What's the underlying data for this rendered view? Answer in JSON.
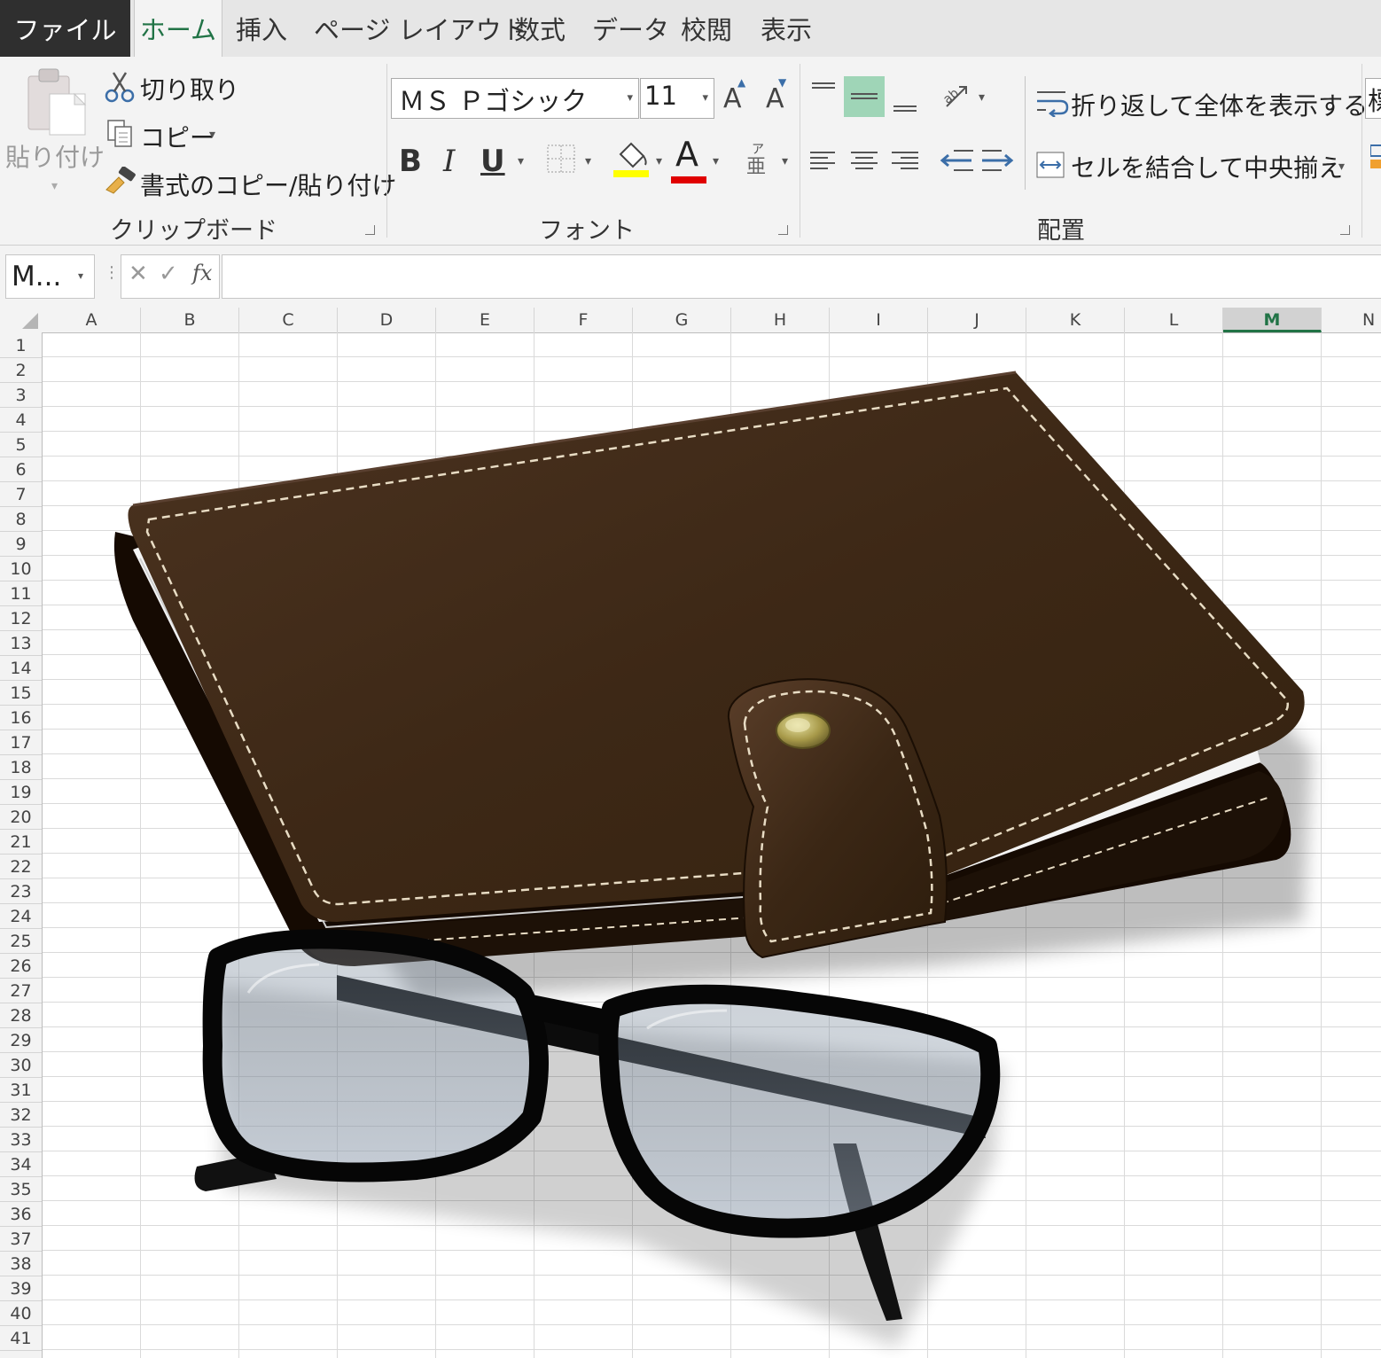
{
  "tabs": {
    "file": "ファイル",
    "home": "ホーム",
    "insert": "挿入",
    "page_layout": "ページ レイアウト",
    "formulas": "数式",
    "data": "データ",
    "review": "校閲",
    "view": "表示"
  },
  "clipboard": {
    "paste": "貼り付け",
    "cut": "切り取り",
    "copy": "コピー",
    "format_painter": "書式のコピー/貼り付け",
    "group": "クリップボード"
  },
  "font": {
    "name": "ＭＳ Ｐゴシック",
    "size": "11",
    "bold": "B",
    "italic": "I",
    "underline": "U",
    "grow": "A",
    "shrink": "A",
    "color": "A",
    "phonetic": "亜",
    "phonetic_ruby": "ア",
    "group": "フォント",
    "fill_color": "#ffff00",
    "font_color": "#ff0000"
  },
  "alignment": {
    "wrap_text": "折り返して全体を表示する",
    "merge_center": "セルを結合して中央揃え",
    "group": "配置"
  },
  "number": {
    "format_fragment": "標"
  },
  "formula_bar": {
    "name_box": "M...",
    "fx": "fx",
    "value": ""
  },
  "columns": [
    "A",
    "B",
    "C",
    "D",
    "E",
    "F",
    "G",
    "H",
    "I",
    "J",
    "K",
    "L",
    "M",
    "N"
  ],
  "selected_column": "M",
  "rows": [
    "1",
    "2",
    "3",
    "4",
    "5",
    "6",
    "7",
    "8",
    "9",
    "10",
    "11",
    "12",
    "13",
    "14",
    "15",
    "16",
    "17",
    "18",
    "19",
    "20",
    "21",
    "22",
    "23",
    "24",
    "25",
    "26",
    "27",
    "28",
    "29",
    "30",
    "31",
    "32",
    "33",
    "34",
    "35",
    "36",
    "37",
    "38",
    "39",
    "40",
    "41"
  ],
  "accent_color": "#217346"
}
